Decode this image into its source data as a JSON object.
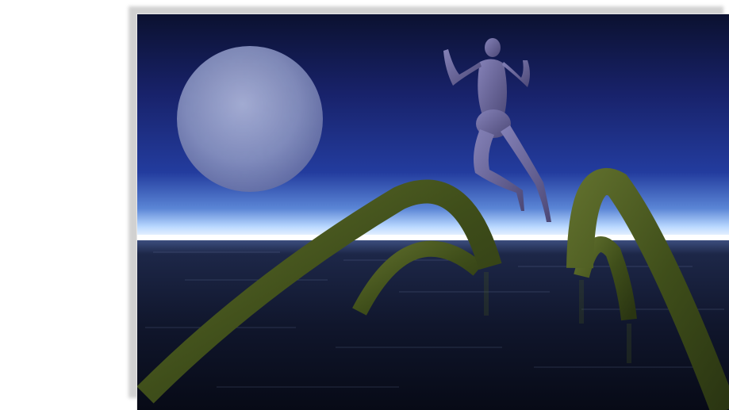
{
  "image": {
    "scene": "surreal-night-seascape",
    "elements": [
      "moon",
      "figure",
      "arches",
      "sea",
      "horizon-glow"
    ]
  },
  "colors": {
    "sky_top": "#0c1233",
    "sky_mid": "#1f2f8a",
    "horizon": "#e8f4ff",
    "sea": "#0c1020",
    "arch": "#4a5a1e",
    "moon": "#8d98c4",
    "figure": "#6e6aa0"
  }
}
